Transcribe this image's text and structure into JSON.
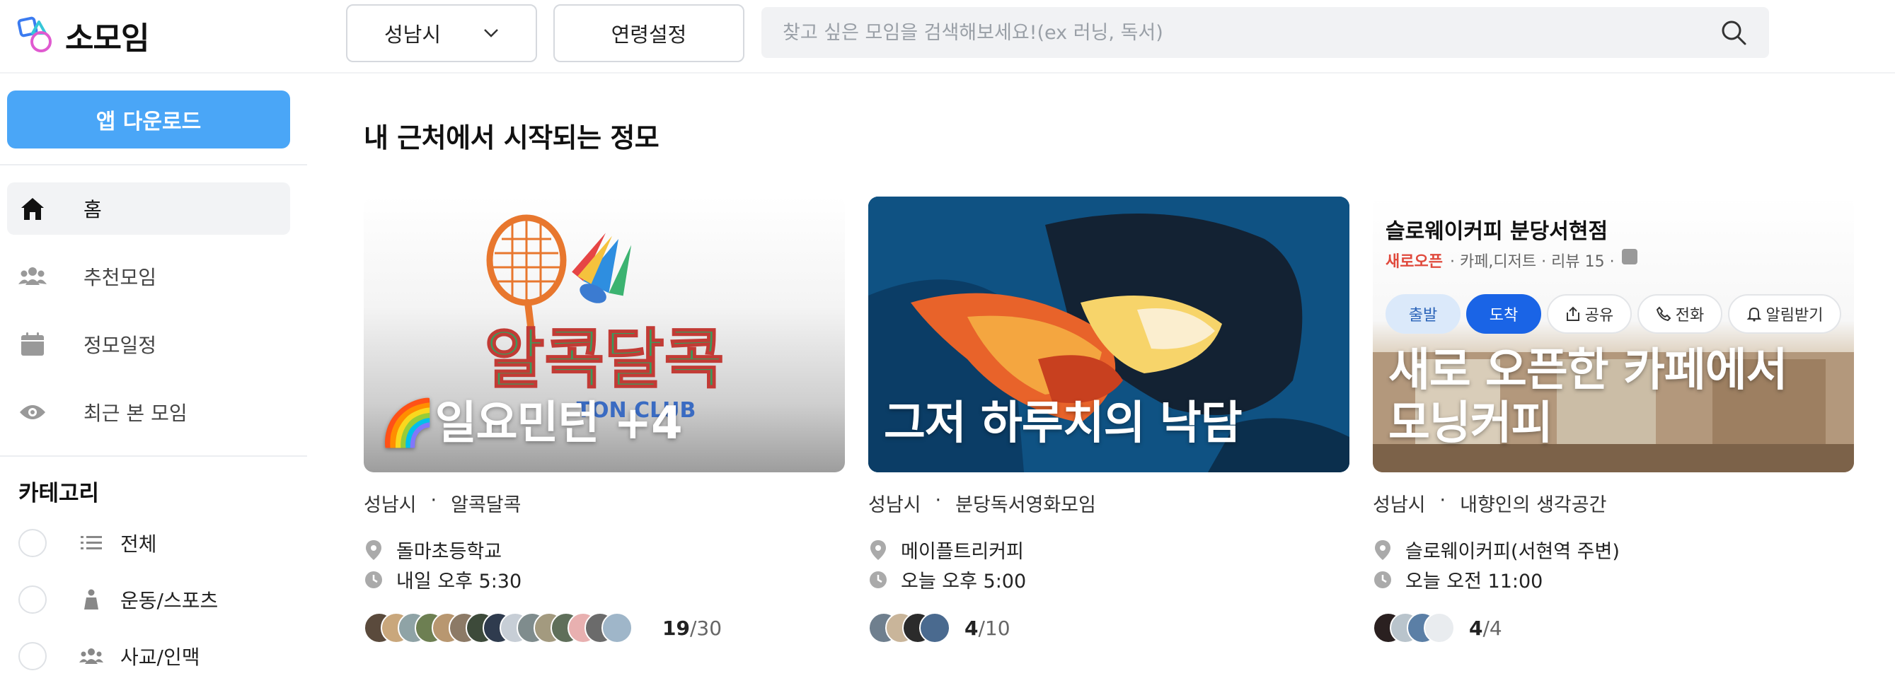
{
  "header": {
    "logo_text": "소모임",
    "region": "성남시",
    "age_setting": "연령설정",
    "search_placeholder": "찾고 싶은 모임을 검색해보세요!(ex 러닝, 독서)"
  },
  "sidebar": {
    "download_label": "앱 다운로드",
    "nav": [
      {
        "label": "홈",
        "icon": "home-icon"
      },
      {
        "label": "추천모임",
        "icon": "people-icon"
      },
      {
        "label": "정모일정",
        "icon": "calendar-icon"
      },
      {
        "label": "최근 본 모임",
        "icon": "eye-icon"
      }
    ],
    "category_title": "카테고리",
    "categories": [
      {
        "label": "전체",
        "icon": "list-icon"
      },
      {
        "label": "운동/스포츠",
        "icon": "sports-icon"
      },
      {
        "label": "사교/인맥",
        "icon": "social-icon"
      }
    ]
  },
  "main": {
    "section_title": "내 근처에서 시작되는 정모",
    "cards": [
      {
        "overlay_title": "🌈일요민턴 +4",
        "image_text": "알콕달콕",
        "image_subtext": "TON CLUB",
        "city": "성남시",
        "group": "알콕달콕",
        "location": "돌마초등학교",
        "time": "내일 오후 5:30",
        "members_current": "19",
        "members_total": "/30"
      },
      {
        "overlay_title": "그저 하루치의 낙담",
        "city": "성남시",
        "group": "분당독서영화모임",
        "location": "메이플트리커피",
        "time": "오늘 오후 5:00",
        "members_current": "4",
        "members_total": "/10"
      },
      {
        "overlay_title": "새로 오픈한 카페에서 모닝커피",
        "place_name": "슬로웨이커피 분당서현점",
        "place_badge": "새로오픈",
        "place_info": "· 카페,디저트 · 리뷰 15 ·",
        "chips": [
          "출발",
          "도착",
          "공유",
          "전화",
          "알림받기"
        ],
        "city": "성남시",
        "group": "내향인의 생각공간",
        "location": "슬로웨이커피(서현역 주변)",
        "time": "오늘 오전 11:00",
        "members_current": "4",
        "members_total": "/4"
      }
    ]
  },
  "colors": {
    "accent": "#4aa6f7",
    "chip_primary": "#1a64e6",
    "new_badge": "#e0493c"
  }
}
